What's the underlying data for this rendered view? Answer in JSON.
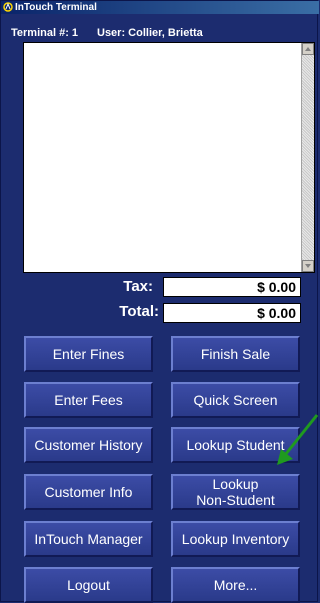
{
  "window": {
    "title": "InTouch Terminal"
  },
  "info": {
    "terminal": "Terminal #: 1",
    "user": "User: Collier, Brietta"
  },
  "totals": {
    "tax_label": "Tax:",
    "tax_value": "$ 0.00",
    "total_label": "Total:",
    "total_value": "$ 0.00"
  },
  "buttons": {
    "enter_fines": "Enter Fines",
    "finish_sale": "Finish Sale",
    "enter_fees": "Enter Fees",
    "quick_screen": "Quick Screen",
    "customer_history": "Customer History",
    "lookup_student": "Lookup Student",
    "customer_info": "Customer Info",
    "lookup_non_student": "Lookup\nNon-Student",
    "intouch_manager": "InTouch Manager",
    "lookup_inventory": "Lookup Inventory",
    "logout": "Logout",
    "more": "More..."
  },
  "colors": {
    "background": "#1c2c6f",
    "button": "#3c4ca6",
    "annotation_arrow": "#1f9a1f"
  },
  "icons": {
    "app": "app-icon",
    "annotation": "green-arrow-icon"
  }
}
